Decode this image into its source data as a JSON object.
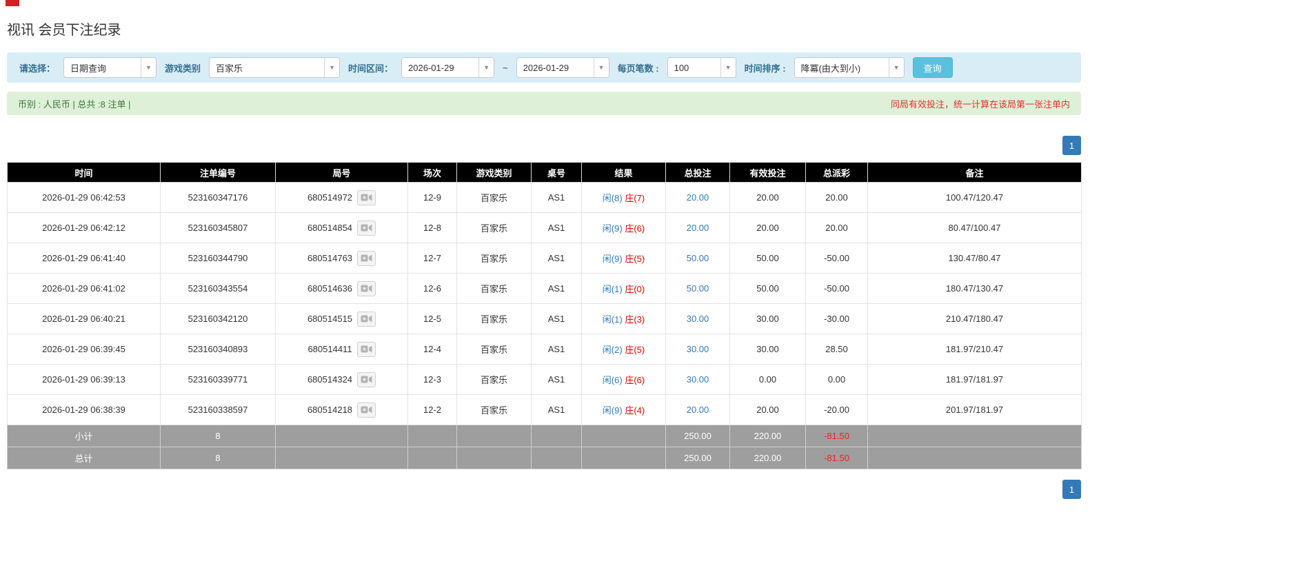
{
  "page": {
    "title": "视讯 会员下注纪录"
  },
  "filters": {
    "select_label": "请选择：",
    "select_value": "日期查询",
    "game_type_label": "游戏类别",
    "game_type_value": "百家乐",
    "date_range_label": "时间区间：",
    "date_from": "2026-01-29",
    "tilde": "~",
    "date_to": "2026-01-29",
    "page_size_label": "每页笔数 :",
    "page_size_value": "100",
    "sort_label": "时间排序 :",
    "sort_value": "降冪(由大到小)",
    "search_button": "查询"
  },
  "summary": {
    "left": "币别 : 人民币 | 总共 :8 注单 |",
    "right": "同局有效投注，统一计算在该局第一张注单内"
  },
  "pagination": {
    "page": "1"
  },
  "colors": {
    "accent_blue": "#337ab7",
    "info_bg": "#d9edf7",
    "success_bg": "#dff0d8",
    "danger_red": "#e60000",
    "header_black": "#000000",
    "footer_gray": "#9e9e9e"
  },
  "table": {
    "headers": [
      "时间",
      "注单编号",
      "局号",
      "场次",
      "游戏类别",
      "桌号",
      "结果",
      "总投注",
      "有效投注",
      "总派彩",
      "备注"
    ],
    "rows": [
      {
        "time": "2026-01-29 06:42:53",
        "bet_id": "523160347176",
        "round": "680514972",
        "session": "12-9",
        "game": "百家乐",
        "table": "AS1",
        "result_player": "闲(8)",
        "result_banker": "庄(7)",
        "total_bet": "20.00",
        "valid_bet": "20.00",
        "payout": "20.00",
        "note": "100.47/120.47"
      },
      {
        "time": "2026-01-29 06:42:12",
        "bet_id": "523160345807",
        "round": "680514854",
        "session": "12-8",
        "game": "百家乐",
        "table": "AS1",
        "result_player": "闲(9)",
        "result_banker": "庄(6)",
        "total_bet": "20.00",
        "valid_bet": "20.00",
        "payout": "20.00",
        "note": "80.47/100.47"
      },
      {
        "time": "2026-01-29 06:41:40",
        "bet_id": "523160344790",
        "round": "680514763",
        "session": "12-7",
        "game": "百家乐",
        "table": "AS1",
        "result_player": "闲(9)",
        "result_banker": "庄(5)",
        "total_bet": "50.00",
        "valid_bet": "50.00",
        "payout": "-50.00",
        "note": "130.47/80.47"
      },
      {
        "time": "2026-01-29 06:41:02",
        "bet_id": "523160343554",
        "round": "680514636",
        "session": "12-6",
        "game": "百家乐",
        "table": "AS1",
        "result_player": "闲(1)",
        "result_banker": "庄(0)",
        "total_bet": "50.00",
        "valid_bet": "50.00",
        "payout": "-50.00",
        "note": "180.47/130.47"
      },
      {
        "time": "2026-01-29 06:40:21",
        "bet_id": "523160342120",
        "round": "680514515",
        "session": "12-5",
        "game": "百家乐",
        "table": "AS1",
        "result_player": "闲(1)",
        "result_banker": "庄(3)",
        "total_bet": "30.00",
        "valid_bet": "30.00",
        "payout": "-30.00",
        "note": "210.47/180.47"
      },
      {
        "time": "2026-01-29 06:39:45",
        "bet_id": "523160340893",
        "round": "680514411",
        "session": "12-4",
        "game": "百家乐",
        "table": "AS1",
        "result_player": "闲(2)",
        "result_banker": "庄(5)",
        "total_bet": "30.00",
        "valid_bet": "30.00",
        "payout": "28.50",
        "note": "181.97/210.47"
      },
      {
        "time": "2026-01-29 06:39:13",
        "bet_id": "523160339771",
        "round": "680514324",
        "session": "12-3",
        "game": "百家乐",
        "table": "AS1",
        "result_player": "闲(6)",
        "result_banker": "庄(6)",
        "total_bet": "30.00",
        "valid_bet": "0.00",
        "payout": "0.00",
        "note": "181.97/181.97"
      },
      {
        "time": "2026-01-29 06:38:39",
        "bet_id": "523160338597",
        "round": "680514218",
        "session": "12-2",
        "game": "百家乐",
        "table": "AS1",
        "result_player": "闲(9)",
        "result_banker": "庄(4)",
        "total_bet": "20.00",
        "valid_bet": "20.00",
        "payout": "-20.00",
        "note": "201.97/181.97"
      }
    ],
    "subtotal": {
      "label": "小计",
      "count": "8",
      "total_bet": "250.00",
      "valid_bet": "220.00",
      "payout": "-81.50"
    },
    "total": {
      "label": "总计",
      "count": "8",
      "total_bet": "250.00",
      "valid_bet": "220.00",
      "payout": "-81.50"
    }
  }
}
